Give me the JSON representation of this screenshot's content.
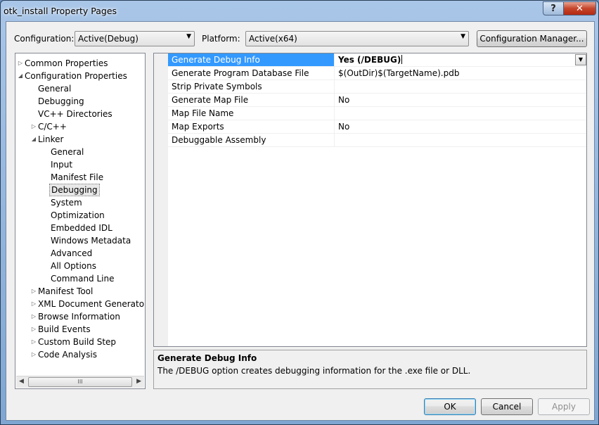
{
  "window": {
    "title": "otk_install Property Pages",
    "help_label": "?",
    "close_label": "✕"
  },
  "toolbar": {
    "configuration_label": "Configuration:",
    "configuration_value": "Active(Debug)",
    "platform_label": "Platform:",
    "platform_value": "Active(x64)",
    "config_manager_label": "Configuration Manager..."
  },
  "tree": {
    "items": [
      {
        "label": "Common Properties",
        "level": 0,
        "expander": "collapsed"
      },
      {
        "label": "Configuration Properties",
        "level": 0,
        "expander": "expanded"
      },
      {
        "label": "General",
        "level": 1,
        "expander": "none"
      },
      {
        "label": "Debugging",
        "level": 1,
        "expander": "none"
      },
      {
        "label": "VC++ Directories",
        "level": 1,
        "expander": "none"
      },
      {
        "label": "C/C++",
        "level": 1,
        "expander": "collapsed"
      },
      {
        "label": "Linker",
        "level": 1,
        "expander": "expanded"
      },
      {
        "label": "General",
        "level": 2,
        "expander": "none"
      },
      {
        "label": "Input",
        "level": 2,
        "expander": "none"
      },
      {
        "label": "Manifest File",
        "level": 2,
        "expander": "none"
      },
      {
        "label": "Debugging",
        "level": 2,
        "expander": "none",
        "selected": true
      },
      {
        "label": "System",
        "level": 2,
        "expander": "none"
      },
      {
        "label": "Optimization",
        "level": 2,
        "expander": "none"
      },
      {
        "label": "Embedded IDL",
        "level": 2,
        "expander": "none"
      },
      {
        "label": "Windows Metadata",
        "level": 2,
        "expander": "none"
      },
      {
        "label": "Advanced",
        "level": 2,
        "expander": "none"
      },
      {
        "label": "All Options",
        "level": 2,
        "expander": "none"
      },
      {
        "label": "Command Line",
        "level": 2,
        "expander": "none"
      },
      {
        "label": "Manifest Tool",
        "level": 1,
        "expander": "collapsed"
      },
      {
        "label": "XML Document Generator",
        "level": 1,
        "expander": "collapsed"
      },
      {
        "label": "Browse Information",
        "level": 1,
        "expander": "collapsed"
      },
      {
        "label": "Build Events",
        "level": 1,
        "expander": "collapsed"
      },
      {
        "label": "Custom Build Step",
        "level": 1,
        "expander": "collapsed"
      },
      {
        "label": "Code Analysis",
        "level": 1,
        "expander": "collapsed"
      }
    ],
    "scroll_grip": "III"
  },
  "properties": [
    {
      "name": "Generate Debug Info",
      "value": "Yes (/DEBUG)",
      "selected": true
    },
    {
      "name": "Generate Program Database File",
      "value": "$(OutDir)$(TargetName).pdb"
    },
    {
      "name": "Strip Private Symbols",
      "value": ""
    },
    {
      "name": "Generate Map File",
      "value": "No"
    },
    {
      "name": "Map File Name",
      "value": ""
    },
    {
      "name": "Map Exports",
      "value": "No"
    },
    {
      "name": "Debuggable Assembly",
      "value": ""
    }
  ],
  "description": {
    "title": "Generate Debug Info",
    "text": "The /DEBUG option creates debugging information for the .exe file or DLL."
  },
  "buttons": {
    "ok": "OK",
    "cancel": "Cancel",
    "apply": "Apply"
  },
  "icons": {
    "collapsed": "triangle-right-icon",
    "expanded": "triangle-down-icon",
    "dropdown": "chevron-down-icon"
  },
  "colors": {
    "selection": "#3399ff",
    "title_bar": "#a9c6e8"
  }
}
